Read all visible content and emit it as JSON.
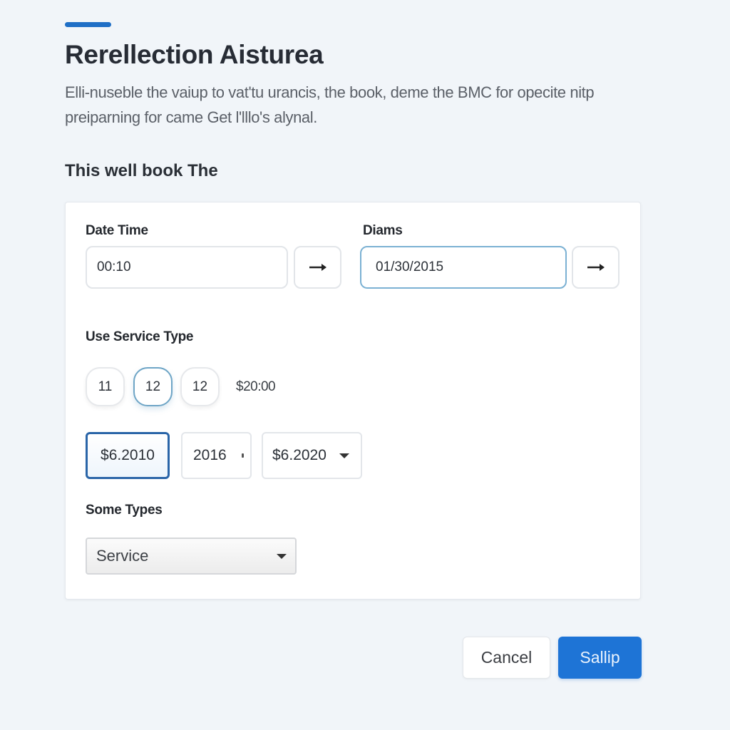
{
  "header": {
    "title": "Rerellection Aisturea",
    "description": "Elli-nuseble the vaiup to vat'tu urancis, the book, deme the BMC for opecite nitp preiparning for came Get l'lllo's alynal.",
    "section_heading": "This well book The"
  },
  "form": {
    "date_time": {
      "label": "Date Time",
      "value": "00:10",
      "action_icon": "arrow-right-icon"
    },
    "diams": {
      "label": "Diams",
      "value": "01/30/2015",
      "action_icon": "arrow-right-icon"
    },
    "service_type": {
      "label": "Use Service Type",
      "chips": [
        {
          "label": "11",
          "selected": false
        },
        {
          "label": "12",
          "selected": true
        },
        {
          "label": "12",
          "selected": false
        }
      ],
      "price": "$20:00"
    },
    "options": [
      {
        "label": "$6.2010",
        "selected": true
      },
      {
        "label": "2016",
        "selected": false
      },
      {
        "label": "$6.2020",
        "selected": false,
        "has_dropdown": true
      }
    ],
    "some_types": {
      "label": "Some Types",
      "selected": "Service"
    }
  },
  "actions": {
    "cancel_label": "Cancel",
    "submit_label": "Sallip"
  },
  "colors": {
    "accent": "#1f6fc6",
    "primary_button": "#1e74d6",
    "focus_border": "#7bb1d3",
    "selected_option_border": "#2a65a8",
    "background": "#f1f5f9"
  }
}
